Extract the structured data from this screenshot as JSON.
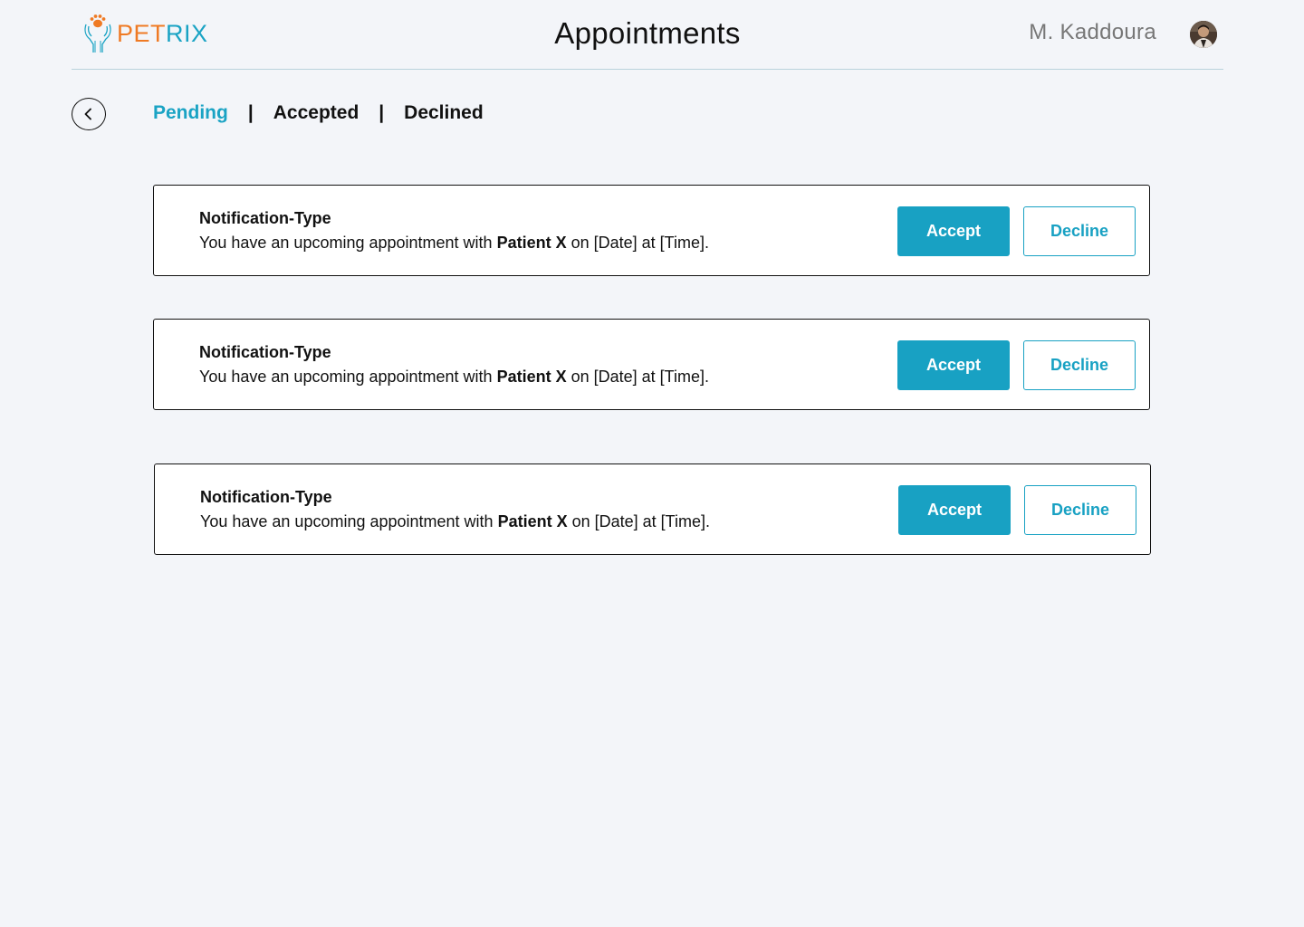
{
  "brand": {
    "name_part1": "PET",
    "name_part2": "RIX",
    "primary_color": "#1aa3c4",
    "accent_color": "#ef7a24"
  },
  "header": {
    "title": "Appointments",
    "user_name": "M. Kaddoura"
  },
  "tabs": [
    {
      "label": "Pending",
      "active": true
    },
    {
      "label": "Accepted",
      "active": false
    },
    {
      "label": "Declined",
      "active": false
    }
  ],
  "tab_separator": "|",
  "notifications": [
    {
      "type": "Notification-Type",
      "msg_prefix": "You have an upcoming appointment with",
      "patient": "Patient X",
      "msg_suffix": "on [Date] at [Time].",
      "accept_label": "Accept",
      "decline_label": "Decline"
    },
    {
      "type": "Notification-Type",
      "msg_prefix": "You have an upcoming appointment with",
      "patient": "Patient X",
      "msg_suffix": "on [Date] at [Time].",
      "accept_label": "Accept",
      "decline_label": "Decline"
    },
    {
      "type": "Notification-Type",
      "msg_prefix": "You have an upcoming appointment with",
      "patient": "Patient X",
      "msg_suffix": "on [Date] at [Time].",
      "accept_label": "Accept",
      "decline_label": "Decline"
    }
  ]
}
